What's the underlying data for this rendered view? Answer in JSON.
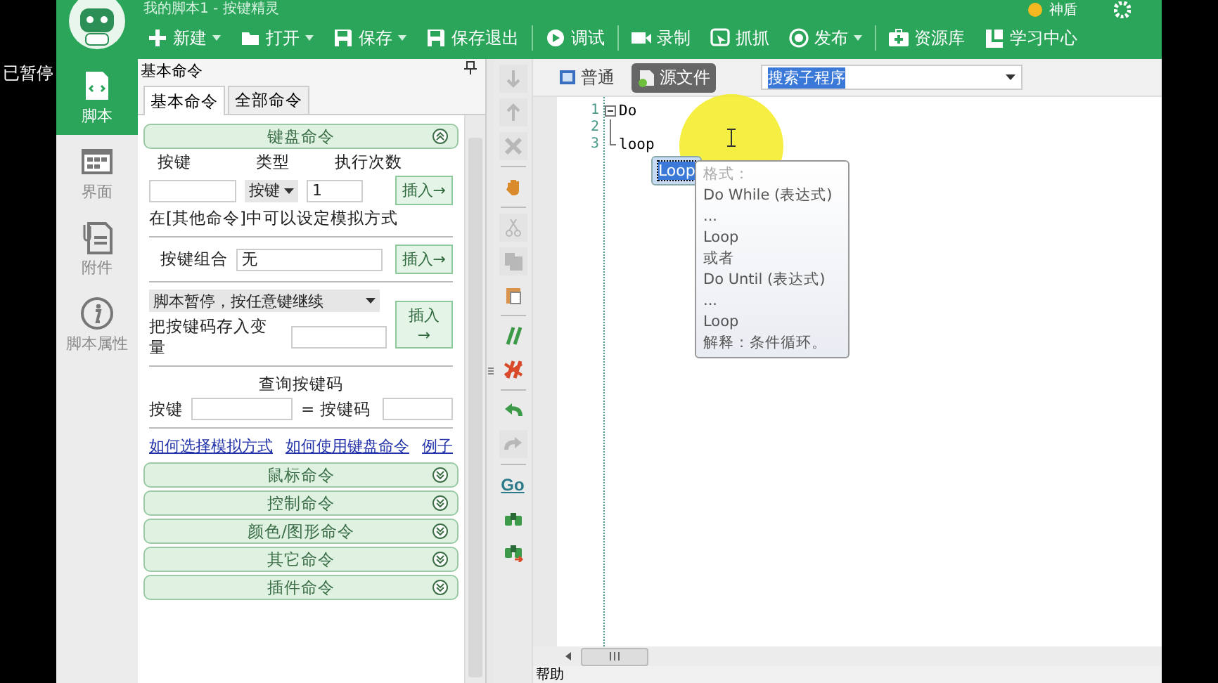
{
  "overlay_text": "已暂停",
  "window": {
    "title": "我的脚本1 - 按键精灵",
    "user": "神盾"
  },
  "toolbar": [
    {
      "kind": "button",
      "label": "新建",
      "dropdown": true
    },
    {
      "kind": "button",
      "label": "打开",
      "dropdown": true
    },
    {
      "kind": "button",
      "label": "保存",
      "dropdown": true
    },
    {
      "kind": "button",
      "label": "保存退出",
      "dropdown": false
    },
    {
      "kind": "separator"
    },
    {
      "kind": "button",
      "label": "调试",
      "dropdown": false
    },
    {
      "kind": "separator"
    },
    {
      "kind": "button",
      "label": "录制",
      "dropdown": false
    },
    {
      "kind": "button",
      "label": "抓抓",
      "dropdown": false
    },
    {
      "kind": "button",
      "label": "发布",
      "dropdown": true
    },
    {
      "kind": "separator"
    },
    {
      "kind": "button",
      "label": "资源库",
      "dropdown": false
    },
    {
      "kind": "button",
      "label": "学习中心",
      "dropdown": false
    }
  ],
  "sidebar": {
    "items": [
      {
        "label": "脚本",
        "selected": true
      },
      {
        "label": "界面",
        "selected": false
      },
      {
        "label": "附件",
        "selected": false
      },
      {
        "label": "脚本属性",
        "selected": false
      }
    ]
  },
  "panel": {
    "title": "基本命令",
    "tabs": [
      {
        "label": "基本命令",
        "selected": true
      },
      {
        "label": "全部命令",
        "selected": false
      }
    ],
    "keyboard": {
      "title": "键盘命令",
      "expanded": true,
      "key_label": "按键",
      "type_label": "类型",
      "count_label": "执行次数",
      "type_value": "按键",
      "count_value": "1",
      "insert": "插入→",
      "note": "在[其他命令]中可以设定模拟方式",
      "combo_label": "按键组合",
      "combo_value": "无",
      "insert2": "插入→",
      "pause_value": "脚本暂停，按任意键继续",
      "store_label": "把按键码存入变量",
      "insert3": "插入→",
      "query_title": "查询按键码",
      "query_key": "按键",
      "query_code": "= 按键码",
      "links": [
        "如何选择模拟方式",
        "如何使用键盘命令",
        "例子"
      ]
    },
    "sections": [
      {
        "title": "鼠标命令",
        "expanded": false
      },
      {
        "title": "控制命令",
        "expanded": false
      },
      {
        "title": "颜色/图形命令",
        "expanded": false
      },
      {
        "title": "其它命令",
        "expanded": false
      },
      {
        "title": "插件命令",
        "expanded": false
      }
    ]
  },
  "editor_tools": [
    {
      "kind": "down",
      "disabled": true
    },
    {
      "kind": "up",
      "disabled": true
    },
    {
      "kind": "delete",
      "disabled": true
    },
    {
      "kind": "sep"
    },
    {
      "kind": "hand",
      "disabled": false
    },
    {
      "kind": "sep"
    },
    {
      "kind": "cut",
      "disabled": true
    },
    {
      "kind": "copy",
      "disabled": true
    },
    {
      "kind": "paste",
      "disabled": false
    },
    {
      "kind": "sep"
    },
    {
      "kind": "comment",
      "disabled": false
    },
    {
      "kind": "uncomment",
      "disabled": false
    },
    {
      "kind": "sep"
    },
    {
      "kind": "undo",
      "disabled": false
    },
    {
      "kind": "redo",
      "disabled": true
    },
    {
      "kind": "sep"
    },
    {
      "kind": "go",
      "label": "Go",
      "disabled": false
    },
    {
      "kind": "find",
      "disabled": false
    },
    {
      "kind": "findnext",
      "disabled": false
    }
  ],
  "editor": {
    "views": [
      {
        "label": "普通",
        "selected": false
      },
      {
        "label": "源文件",
        "selected": true
      }
    ],
    "search": {
      "value": "搜索子程序"
    },
    "lines": [
      {
        "number": "1",
        "text": "Do"
      },
      {
        "number": "2"
      },
      {
        "number": "3",
        "text": "loop"
      }
    ],
    "completion": {
      "label": "Loop",
      "selected": true
    },
    "tooltip": [
      "格式：",
      "Do While (表达式)",
      "...",
      "Loop",
      "或者",
      "Do Until (表达式)",
      "...",
      "Loop",
      "解释：条件循环。"
    ]
  },
  "status_bar": {
    "text": "帮助"
  }
}
